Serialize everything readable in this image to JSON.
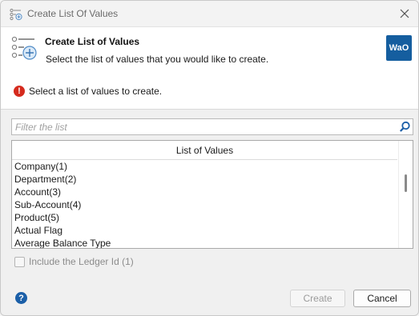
{
  "window": {
    "title": "Create List Of Values"
  },
  "header": {
    "title": "Create List of Values",
    "subtitle": "Select the list of values that you would like to create.",
    "logo_text": "WaO"
  },
  "error": {
    "message": "Select a list of values to create."
  },
  "filter": {
    "placeholder": "Filter the list",
    "value": ""
  },
  "list": {
    "header": "List of Values",
    "items": [
      "Company(1)",
      "Department(2)",
      "Account(3)",
      "Sub-Account(4)",
      "Product(5)",
      "Actual Flag",
      "Average Balance Type"
    ]
  },
  "options": {
    "include_ledger_label": "Include the Ledger Id (1)",
    "include_ledger_checked": false
  },
  "footer": {
    "help_label": "?",
    "create_label": "Create",
    "cancel_label": "Cancel"
  },
  "colors": {
    "accent": "#155e9f",
    "error": "#d52b1e",
    "search": "#1b5fa8"
  }
}
